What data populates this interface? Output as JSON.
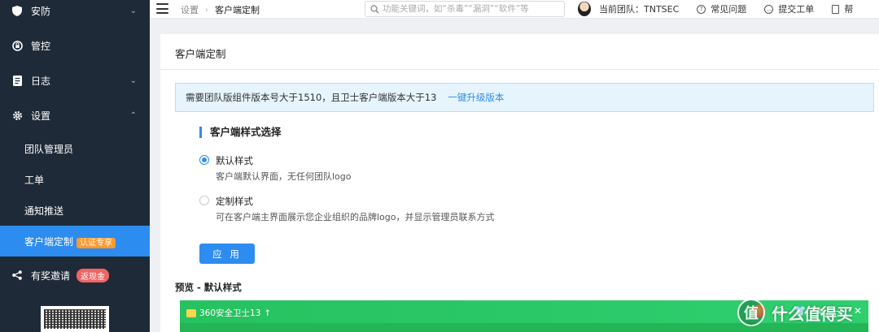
{
  "sidebar": {
    "items": [
      {
        "label": "安防",
        "icon": "shield-icon"
      },
      {
        "label": "管控",
        "icon": "lock-icon"
      },
      {
        "label": "日志",
        "icon": "log-icon"
      },
      {
        "label": "设置",
        "icon": "gear-icon"
      }
    ],
    "sub_items": [
      {
        "label": "团队管理员"
      },
      {
        "label": "工单"
      },
      {
        "label": "通知推送"
      },
      {
        "label": "客户端定制",
        "badge": "认证专享"
      }
    ],
    "reward": {
      "label": "有奖邀请",
      "badge": "返现金",
      "icon": "share-icon"
    }
  },
  "header": {
    "breadcrumb": [
      "设置",
      "客户端定制"
    ],
    "search_placeholder": "功能关键词，如“杀毒”“漏洞”“软件”等",
    "team": "当前团队：TNTSEC",
    "faq": "常见问题",
    "ticket": "提交工单",
    "help": "帮"
  },
  "main": {
    "title": "客户端定制",
    "notice": "需要团队版组件版本号大于1510，且卫士客户端版本大于13",
    "notice_link": "一键升级版本",
    "section_title": "客户端样式选择",
    "options": [
      {
        "label": "默认样式",
        "desc": "客户端默认界面，无任何团队logo",
        "checked": true
      },
      {
        "label": "定制样式",
        "desc": "可在客户端主界面展示您企业组织的品牌logo，并显示管理员联系方式",
        "checked": false
      }
    ],
    "apply_label": "应 用",
    "preview_title": "预览 - 默认样式",
    "preview_window_title": "360安全卫士13"
  },
  "watermark": {
    "text": "什么值得买",
    "glyph": "值"
  },
  "colors": {
    "accent": "#2d8cf0",
    "sidebar_bg": "#1f2a38",
    "preview_green": "#27c160"
  }
}
